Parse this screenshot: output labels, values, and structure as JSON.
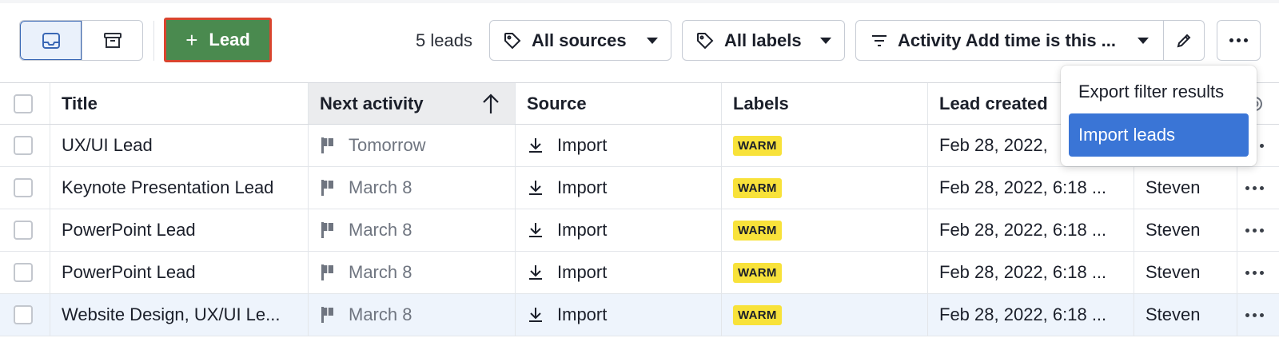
{
  "toolbar": {
    "add_lead_label": "Lead",
    "lead_count": "5 leads",
    "sources_filter": "All sources",
    "labels_filter": "All labels",
    "activity_filter": "Activity Add time is this ..."
  },
  "table": {
    "headers": {
      "title": "Title",
      "next_activity": "Next activity",
      "source": "Source",
      "labels": "Labels",
      "lead_created": "Lead created"
    },
    "rows": [
      {
        "title": "UX/UI Lead",
        "next_activity": "Tomorrow",
        "source": "Import",
        "label": "WARM",
        "created": "Feb 28, 2022,",
        "owner": ""
      },
      {
        "title": "Keynote Presentation Lead",
        "next_activity": "March 8",
        "source": "Import",
        "label": "WARM",
        "created": "Feb 28, 2022, 6:18 ...",
        "owner": "Steven"
      },
      {
        "title": "PowerPoint Lead",
        "next_activity": "March 8",
        "source": "Import",
        "label": "WARM",
        "created": "Feb 28, 2022, 6:18 ...",
        "owner": "Steven"
      },
      {
        "title": "PowerPoint Lead",
        "next_activity": "March 8",
        "source": "Import",
        "label": "WARM",
        "created": "Feb 28, 2022, 6:18 ...",
        "owner": "Steven"
      },
      {
        "title": "Website Design, UX/UI Le...",
        "next_activity": "March 8",
        "source": "Import",
        "label": "WARM",
        "created": "Feb 28, 2022, 6:18 ...",
        "owner": "Steven"
      }
    ]
  },
  "more_menu": {
    "items": [
      "Export filter results",
      "Import leads"
    ],
    "active_index": 1
  },
  "colors": {
    "add_button": "#4a8a4f",
    "add_button_border": "#d9452e",
    "menu_active": "#3a75d6",
    "badge": "#f8e23a"
  }
}
